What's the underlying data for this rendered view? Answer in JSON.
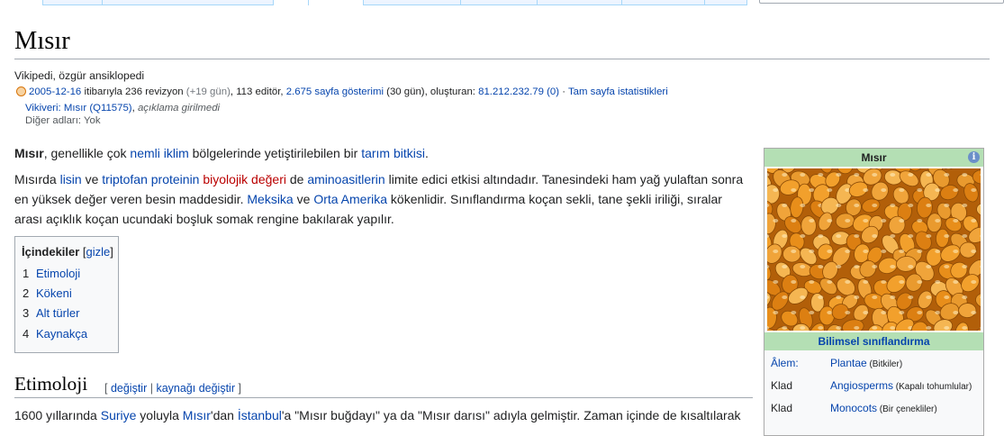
{
  "page": {
    "title": "Mısır",
    "tagline": "Vikipedi, özgür ansiklopedi"
  },
  "stats": {
    "date": "2005-12-16",
    "revisions": " itibarıyla 236 revizyon ",
    "recent": "(+19 gün)",
    "editors": ", 113 editör, ",
    "views": "2.675 sayfa gösterimi",
    "views_period": " (30 gün), oluşturan: ",
    "creator": "81.212.232.79 (0)",
    "separator": " · ",
    "full_stats": "Tam sayfa istatistikleri"
  },
  "wikidata": {
    "label": "Vikiveri: ",
    "link": "Mısır (Q11575)",
    "sep": ", ",
    "note": "açıklama girilmedi"
  },
  "other_names": "Diğer adları: Yok",
  "intro": {
    "bold": "Mısır",
    "t1": ", genellikle çok ",
    "l1": "nemli iklim",
    "t2": " bölgelerinde yetiştirilebilen bir ",
    "l2": "tarım bitkisi",
    "t3": "."
  },
  "para2": {
    "t1": "Mısırda ",
    "l1": "lisin",
    "t2": " ve ",
    "l2": "triptofan",
    "t3": " ",
    "l3": "proteinin",
    "t4": " ",
    "r1": "biyolojik değeri",
    "t5": " de ",
    "l4": "aminoasitlerin",
    "t6": " limite edici etkisi altındadır. Tanesindeki ham yağ yulaftan sonra en yüksek değer veren besin maddesidir. ",
    "l5": "Meksika",
    "t7": " ve ",
    "l6": "Orta Amerika",
    "t8": " kökenlidir. Sınıflandırma koçan sekli, tane şekli iriliği, sıralar arası açıklık koçan ucundaki boşluk somak rengine bakılarak yapılır."
  },
  "toc": {
    "title": "İçindekiler",
    "toggle_open": " [",
    "toggle": "gizle",
    "toggle_close": "]",
    "items": [
      {
        "num": "1",
        "label": "Etimoloji"
      },
      {
        "num": "2",
        "label": "Kökeni"
      },
      {
        "num": "3",
        "label": "Alt türler"
      },
      {
        "num": "4",
        "label": "Kaynakça"
      }
    ]
  },
  "section": {
    "title": "Etimoloji",
    "edit_open": "[ ",
    "edit": "değiştir",
    "edit_sep": " | ",
    "edit_source": "kaynağı değiştir",
    "edit_close": " ]"
  },
  "para3": {
    "t1": "1600 yıllarında ",
    "l1": "Suriye",
    "t2": " yoluyla ",
    "l2": "Mısır",
    "t3": "'dan ",
    "l3": "İstanbul",
    "t4": "'a \"Mısır buğdayı\" ya da \"Mısır darısı\" adıyla gelmiştir. Zaman içinde de kısaltılarak"
  },
  "infobox": {
    "title": "Mısır",
    "info_icon": "i",
    "classification": "Bilimsel sınıflandırma",
    "rows": [
      {
        "key": "Âlem:",
        "value": "Plantae",
        "note": " (Bitkiler)"
      },
      {
        "key": "Klad",
        "value": "Angiosperms",
        "note": " (Kapalı tohumlular)"
      },
      {
        "key": "Klad",
        "value": "Monocots",
        "note": " (Bir çenekliler)"
      }
    ]
  },
  "colors": {
    "link": "#0645ad",
    "redlink": "#ba0000",
    "infobox_header": "#b4dfb4",
    "kernel_orange": "#e8901c"
  },
  "icons": {
    "stats": "orange-circle-icon",
    "infobox_info": "info-icon"
  }
}
